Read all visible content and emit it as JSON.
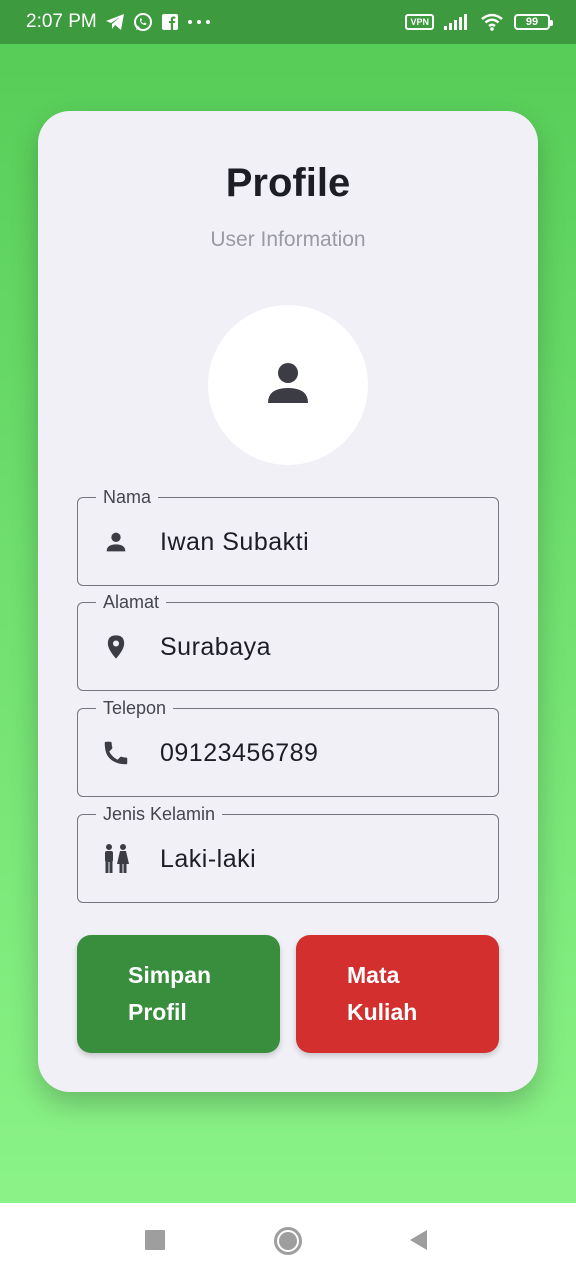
{
  "status_bar": {
    "time": "2:07 PM",
    "left_icons": [
      "telegram-icon",
      "whatsapp-icon",
      "facebook-icon",
      "more-dots-icon"
    ],
    "vpn_label": "VPN",
    "battery_level": "99"
  },
  "card": {
    "title": "Profile",
    "subtitle": "User Information",
    "avatar_icon": "person-icon"
  },
  "fields": [
    {
      "label": "Nama",
      "value": "Iwan Subakti",
      "icon": "person-icon"
    },
    {
      "label": "Alamat",
      "value": "Surabaya",
      "icon": "location-pin-icon"
    },
    {
      "label": "Telepon",
      "value": "09123456789",
      "icon": "phone-icon"
    },
    {
      "label": "Jenis Kelamin",
      "value": "Laki-laki",
      "icon": "gender-icon"
    }
  ],
  "buttons": {
    "save_line1": "Simpan",
    "save_line2": "Profil",
    "courses_line1": "Mata",
    "courses_line2": "Kuliah"
  },
  "colors": {
    "save_button": "#388e3c",
    "courses_button": "#d32f2f",
    "status_bar": "#3d9a3f",
    "card_background": "#f0f0f6"
  },
  "nav_bar": {
    "icons": [
      "recents-square-icon",
      "home-circle-icon",
      "back-triangle-icon"
    ]
  }
}
